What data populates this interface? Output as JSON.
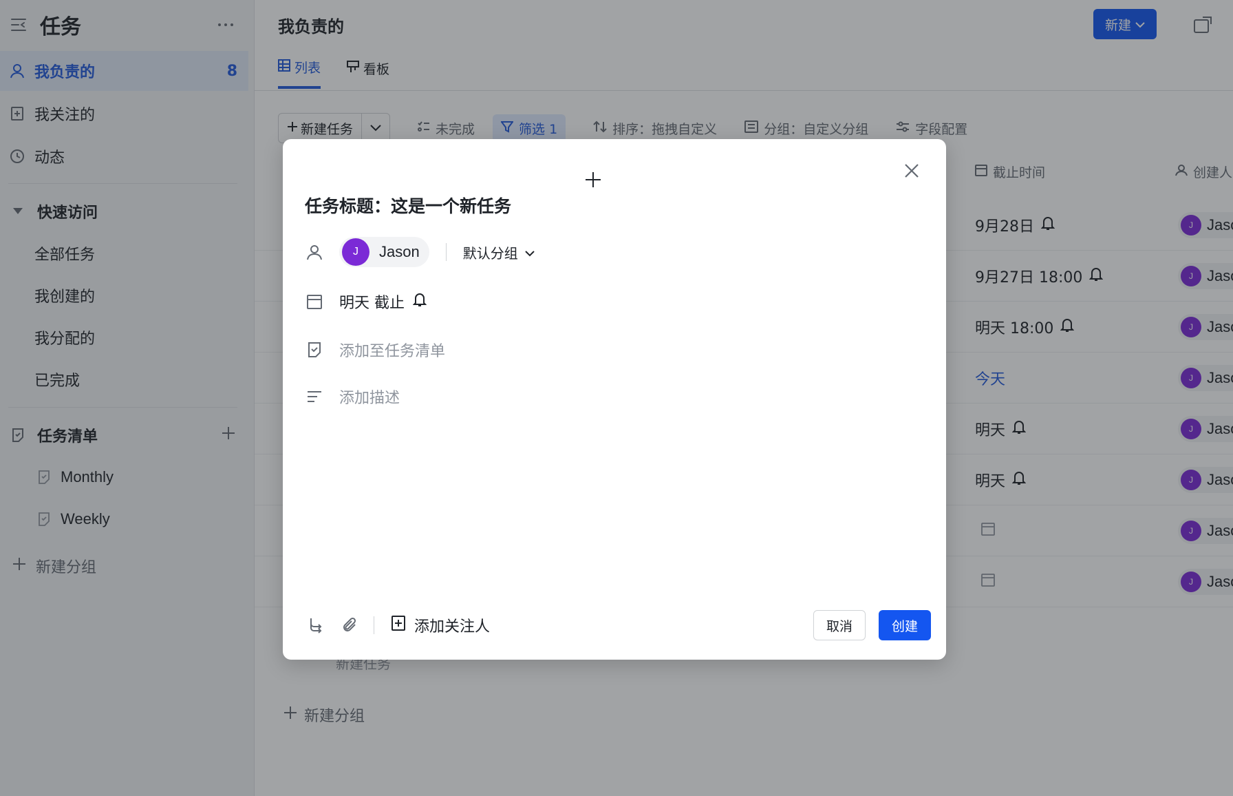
{
  "sidebar": {
    "app_title": "任务",
    "nav": [
      {
        "label": "我负责的",
        "count": "8"
      },
      {
        "label": "我关注的"
      },
      {
        "label": "动态"
      }
    ],
    "quick_access": {
      "label": "快速访问",
      "items": [
        "全部任务",
        "我创建的",
        "我分配的",
        "已完成"
      ]
    },
    "task_lists": {
      "label": "任务清单",
      "items": [
        "Monthly",
        "Weekly"
      ]
    },
    "new_group": "新建分组"
  },
  "main": {
    "title": "我负责的",
    "new_button": "新建",
    "tabs": [
      {
        "label": "列表",
        "active": true
      },
      {
        "label": "看板",
        "active": false
      }
    ],
    "toolbar": {
      "new_task": "新建任务",
      "incomplete": "未完成",
      "filter": "筛选 1",
      "sort": "排序：拖拽自定义",
      "group": "分组：自定义分组",
      "fields": "字段配置"
    },
    "columns": {
      "due": "截止时间",
      "creator": "创建人"
    },
    "rows": [
      {
        "due": "9月28日",
        "bell": true,
        "today": false,
        "creator": "Jason"
      },
      {
        "due": "9月27日 18:00",
        "bell": true,
        "today": false,
        "creator": "Jason"
      },
      {
        "due": "明天 18:00",
        "bell": true,
        "today": false,
        "creator": "Jason"
      },
      {
        "due": "今天",
        "bell": false,
        "today": true,
        "creator": "Jason"
      },
      {
        "due": "明天",
        "bell": true,
        "today": false,
        "creator": "Jason"
      },
      {
        "due": "明天",
        "bell": true,
        "today": false,
        "creator": "Jason"
      },
      {
        "due": "",
        "bell": false,
        "today": false,
        "creator": "Jason"
      },
      {
        "due": "",
        "bell": false,
        "today": false,
        "creator": "Jason"
      }
    ],
    "bottom_new_task": "新建任务",
    "bottom_new_group": "新建分组"
  },
  "modal": {
    "title": "任务标题：这是一个新任务",
    "assignee": {
      "initial": "J",
      "name": "Jason"
    },
    "group": "默认分组",
    "due": "明天 截止",
    "add_to_list": "添加至任务清单",
    "add_description": "添加描述",
    "add_follower": "添加关注人",
    "cancel": "取消",
    "create": "创建"
  },
  "colors": {
    "primary": "#1456f0",
    "active_text": "#245bdb",
    "avatar": "#7b2ad6"
  }
}
